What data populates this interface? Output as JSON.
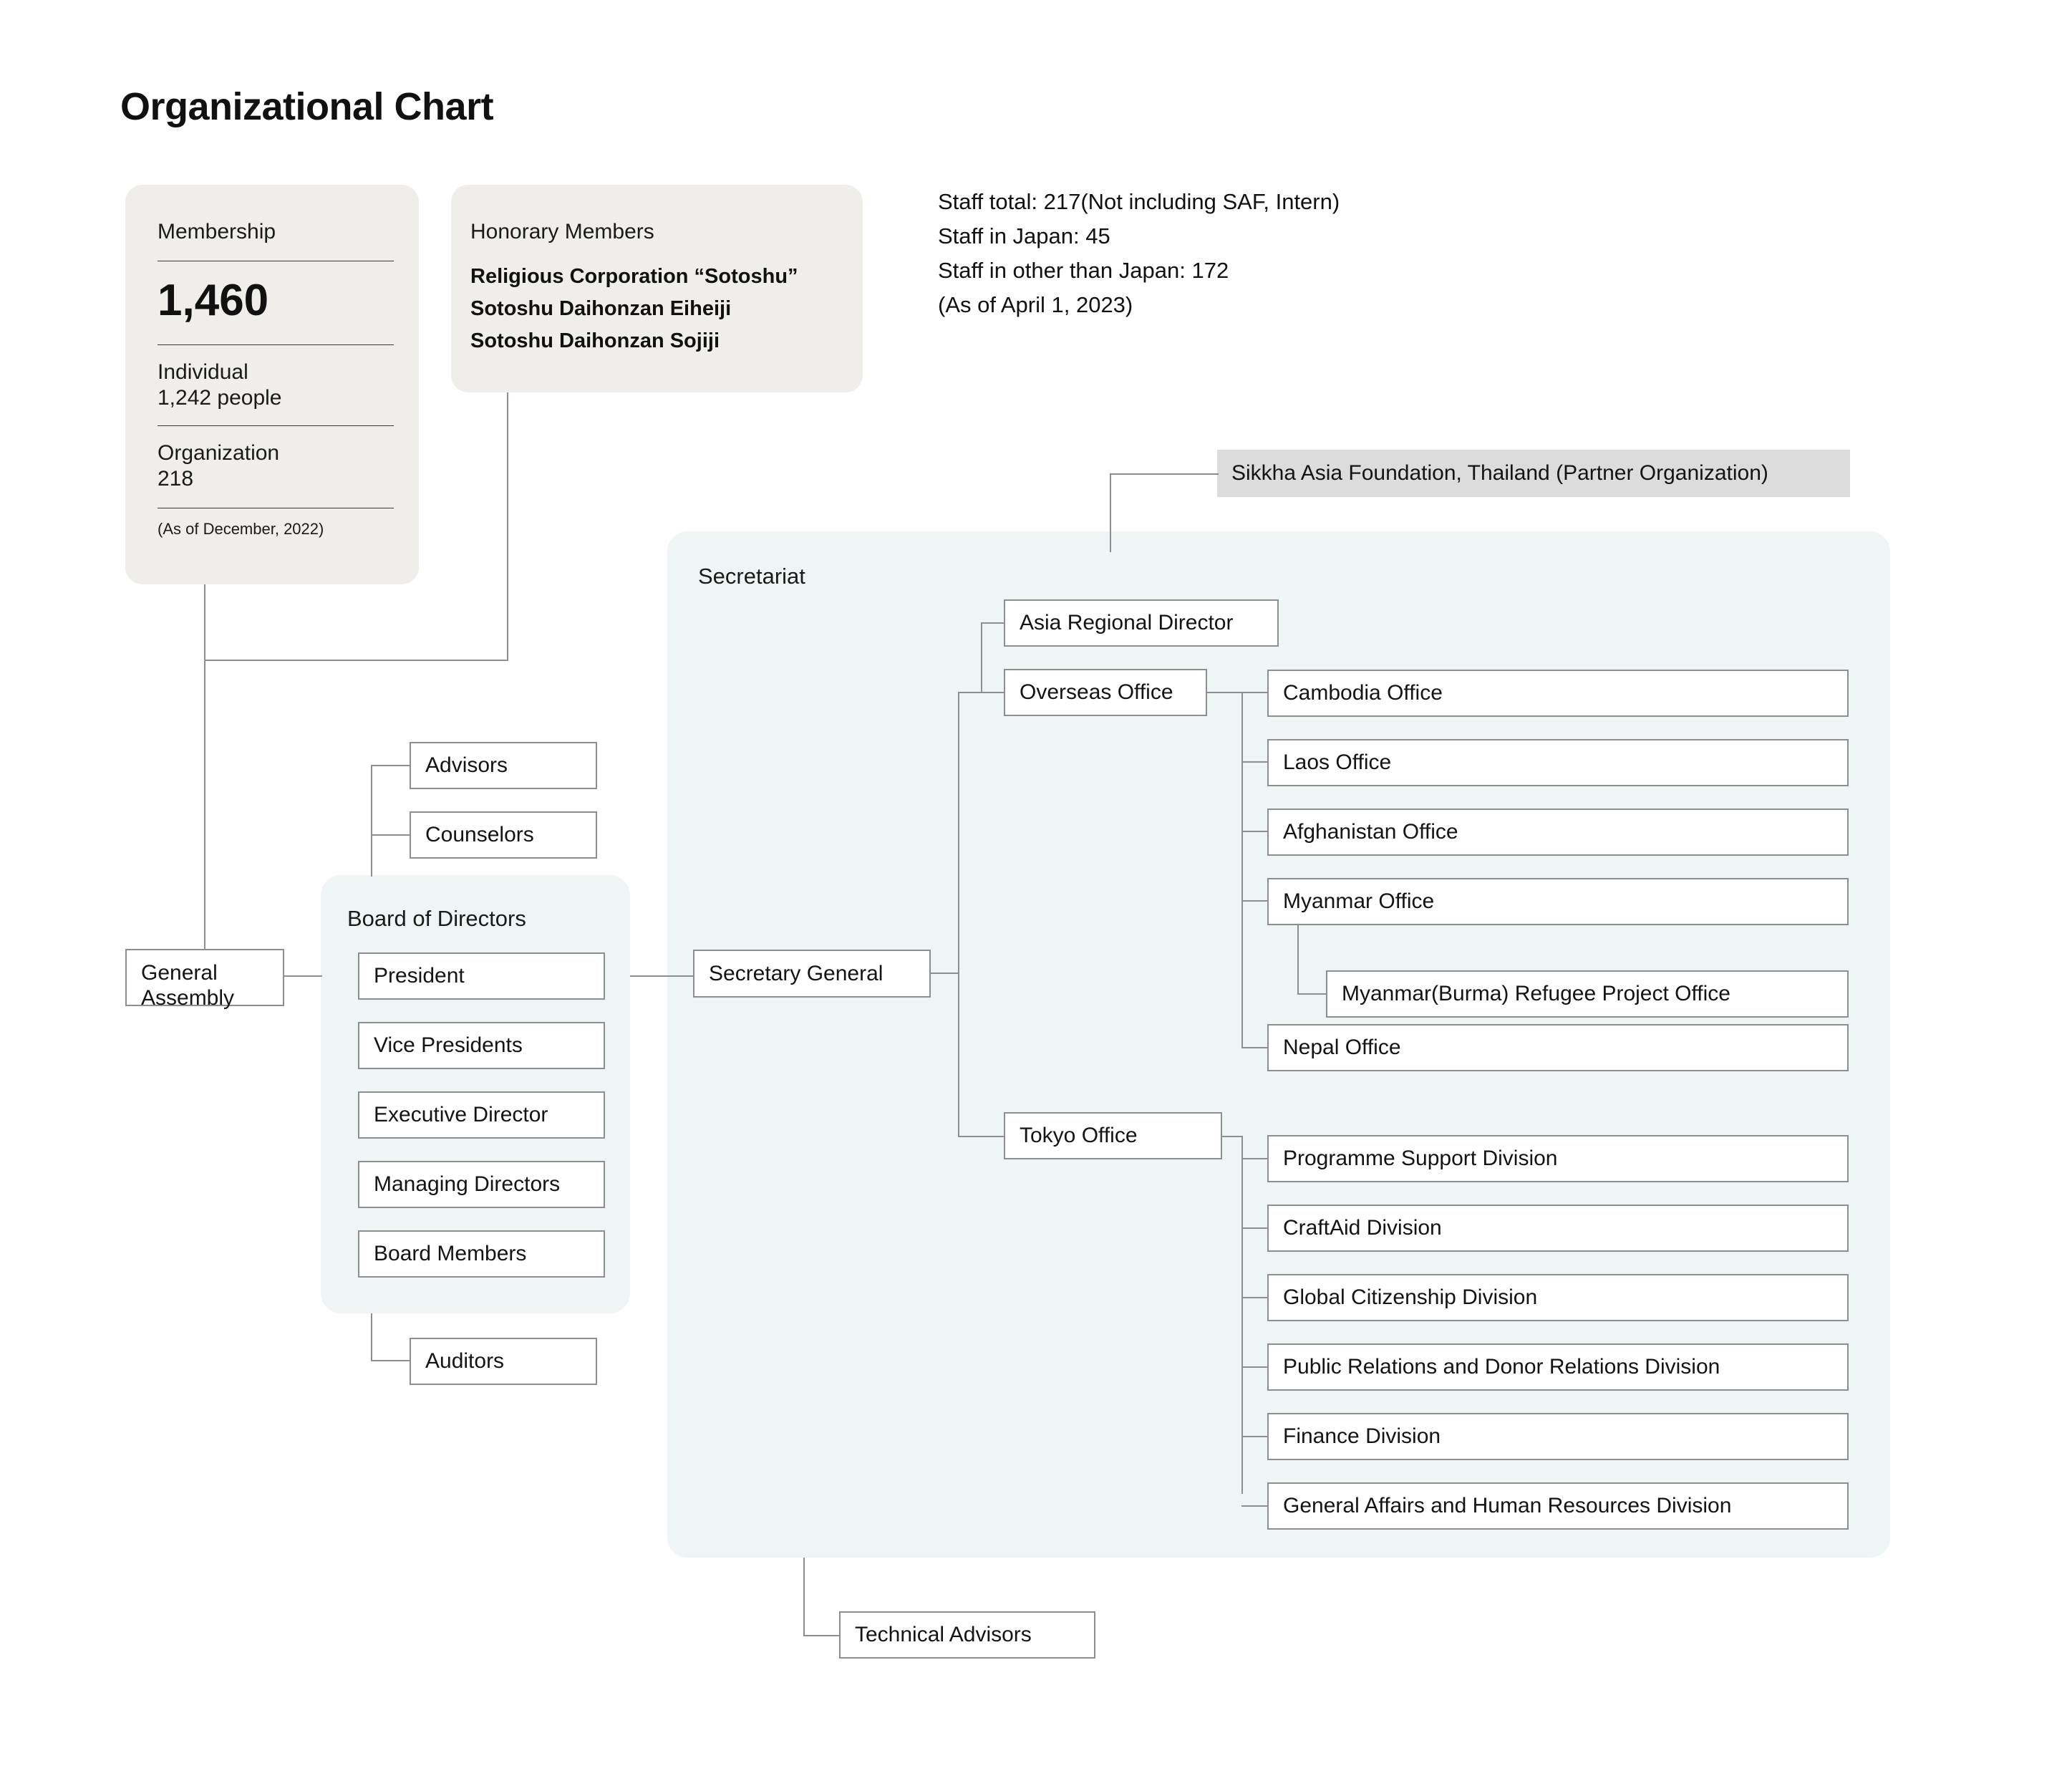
{
  "title": "Organizational Chart",
  "membership_card": {
    "label": "Membership",
    "total": "1,460",
    "individual_label": "Individual",
    "individual_value": "1,242 people",
    "organization_label": "Organization",
    "organization_value": "218",
    "asof": "(As of December, 2022)"
  },
  "honorary_card": {
    "label": "Honorary Members",
    "entries": [
      "Religious Corporation “Sotoshu”",
      "Sotoshu Daihonzan Eiheiji",
      "Sotoshu Daihonzan Sojiji"
    ]
  },
  "staff_info": {
    "lines": [
      "Staff total: 217(Not including SAF, Intern)",
      "Staff in Japan: 45",
      "Staff in other than Japan: 172",
      "(As of April 1, 2023)"
    ]
  },
  "partner": {
    "label": "Sikkha Asia Foundation, Thailand (Partner Organization)"
  },
  "secretariat": {
    "label": "Secretariat",
    "secretary_general": "Secretary General",
    "asia_regional_director": "Asia Regional Director",
    "overseas_office": "Overseas Office",
    "overseas_children": [
      "Cambodia Office",
      "Laos Office",
      "Afghanistan Office",
      "Myanmar Office",
      "Nepal Office"
    ],
    "myanmar_sub": "Myanmar(Burma) Refugee Project Office",
    "tokyo_office": "Tokyo Office",
    "tokyo_children": [
      "Programme Support Division",
      "CraftAid Division",
      "Global Citizenship Division",
      "Public Relations and Donor Relations Division",
      "Finance Division",
      "General Affairs and Human Resources Division"
    ]
  },
  "governance": {
    "general_assembly_line1": "General",
    "general_assembly_line2": "Assembly",
    "advisors": "Advisors",
    "counselors": "Counselors",
    "board_title": "Board of Directors",
    "board_members": [
      "President",
      "Vice Presidents",
      "Executive Director",
      "Managing Directors",
      "Board Members"
    ],
    "auditors": "Auditors"
  },
  "technical_advisors": {
    "label": "Technical Advisors"
  },
  "colors": {
    "card_grey": "#efeeeb",
    "panel_blue": "#eff5f5",
    "partner_grey": "#dcdcdc",
    "line": "#8c8f91",
    "text": "#141414"
  }
}
